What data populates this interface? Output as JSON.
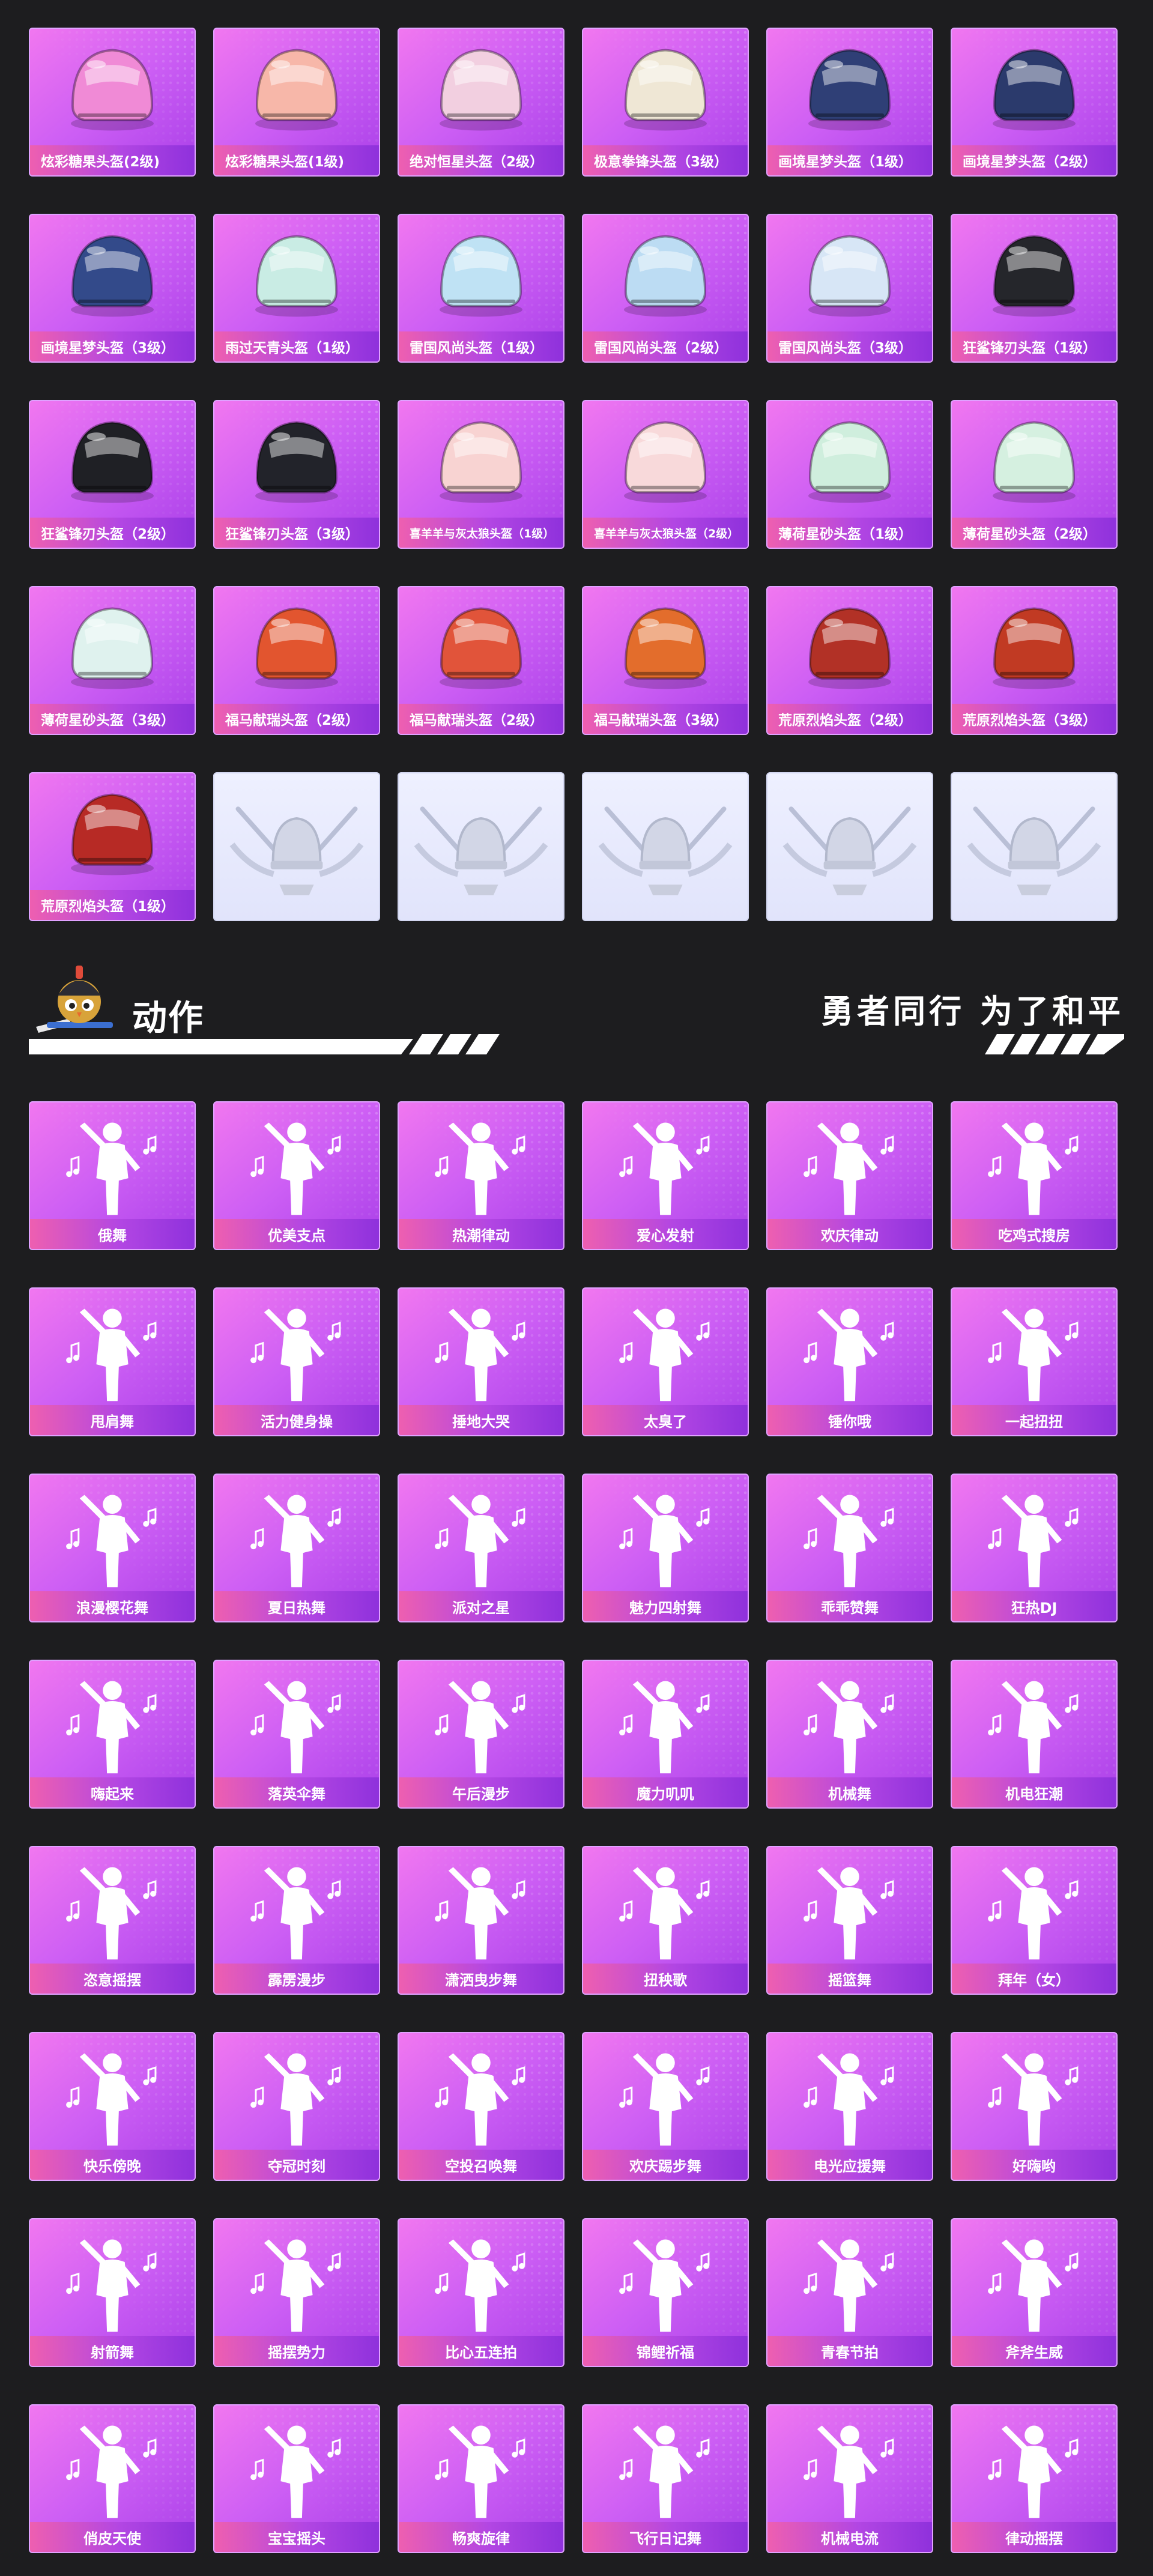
{
  "colors": {
    "background": "#1d1d1f",
    "card_gradient": [
      "#f177f0",
      "#cc5ef4",
      "#a93fe8"
    ],
    "label_gradient": [
      "#ee5fb0",
      "#8f31dc"
    ],
    "empty_card": "#e4e7fb"
  },
  "helmets": {
    "items": [
      {
        "label": "炫彩糖果头盔(2级)",
        "color": "#f08ad6"
      },
      {
        "label": "炫彩糖果头盔(1级)",
        "color": "#f7b7a9"
      },
      {
        "label": "绝对恒星头盔（2级）",
        "color": "#f2cfe0"
      },
      {
        "label": "极意拳锋头盔（3级）",
        "color": "#efe7d5"
      },
      {
        "label": "画境星梦头盔（1级）",
        "color": "#2f3f76"
      },
      {
        "label": "画境星梦头盔（2级）",
        "color": "#2b3a6c"
      },
      {
        "label": "画境星梦头盔（3级）",
        "color": "#334a8a"
      },
      {
        "label": "雨过天青头盔（1级）",
        "color": "#c9ece4"
      },
      {
        "label": "雷国风尚头盔（1级）",
        "color": "#bfe2f4"
      },
      {
        "label": "雷国风尚头盔（2级）",
        "color": "#bcdcf3"
      },
      {
        "label": "雷国风尚头盔（3级）",
        "color": "#d7e6f6"
      },
      {
        "label": "狂鲨锋刃头盔（1级）",
        "color": "#25262b"
      },
      {
        "label": "狂鲨锋刃头盔（2级）",
        "color": "#1f2025"
      },
      {
        "label": "狂鲨锋刃头盔（3级）",
        "color": "#22232a"
      },
      {
        "label": "喜羊羊与灰太狼头盔（1级）",
        "color": "#f8d3d2",
        "small": true
      },
      {
        "label": "喜羊羊与灰太狼头盔（2级）",
        "color": "#f8d9da",
        "small": true
      },
      {
        "label": "薄荷星砂头盔（1级）",
        "color": "#cfeedd"
      },
      {
        "label": "薄荷星砂头盔（2级）",
        "color": "#d5f0e0"
      },
      {
        "label": "薄荷星砂头盔（3级）",
        "color": "#dff2ee"
      },
      {
        "label": "福马献瑞头盔（2级）",
        "color": "#e2552f"
      },
      {
        "label": "福马献瑞头盔（2级）",
        "color": "#e1543a"
      },
      {
        "label": "福马献瑞头盔（3级）",
        "color": "#e36d2c"
      },
      {
        "label": "荒原烈焰头盔（2级）",
        "color": "#b23126"
      },
      {
        "label": "荒原烈焰头盔（3级）",
        "color": "#c13a23"
      },
      {
        "label": "荒原烈焰头盔（1级）",
        "color": "#b72a25"
      }
    ],
    "empty_slots": 5
  },
  "emotes_section": {
    "title": "动作",
    "slogan": "勇者同行 为了和平"
  },
  "emotes": [
    "俄舞",
    "优美支点",
    "热潮律动",
    "爱心发射",
    "欢庆律动",
    "吃鸡式搜房",
    "甩肩舞",
    "活力健身操",
    "捶地大哭",
    "太臭了",
    "锤你哦",
    "一起扭扭",
    "浪漫樱花舞",
    "夏日热舞",
    "派对之星",
    "魅力四射舞",
    "乖乖赞舞",
    "狂热DJ",
    "嗨起来",
    "落英伞舞",
    "午后漫步",
    "魔力叽叽",
    "机械舞",
    "机电狂潮",
    "恣意摇摆",
    "霹雳漫步",
    "潇洒曳步舞",
    "扭秧歌",
    "摇篮舞",
    "拜年（女）",
    "快乐傍晚",
    "夺冠时刻",
    "空投召唤舞",
    "欢庆踢步舞",
    "电光应援舞",
    "好嗨哟",
    "射箭舞",
    "摇摆势力",
    "比心五连拍",
    "锦鲤祈福",
    "青春节拍",
    "斧斧生威",
    "俏皮天使",
    "宝宝摇头",
    "畅爽旋律",
    "飞行日记舞",
    "机械电流",
    "律动摇摆"
  ]
}
